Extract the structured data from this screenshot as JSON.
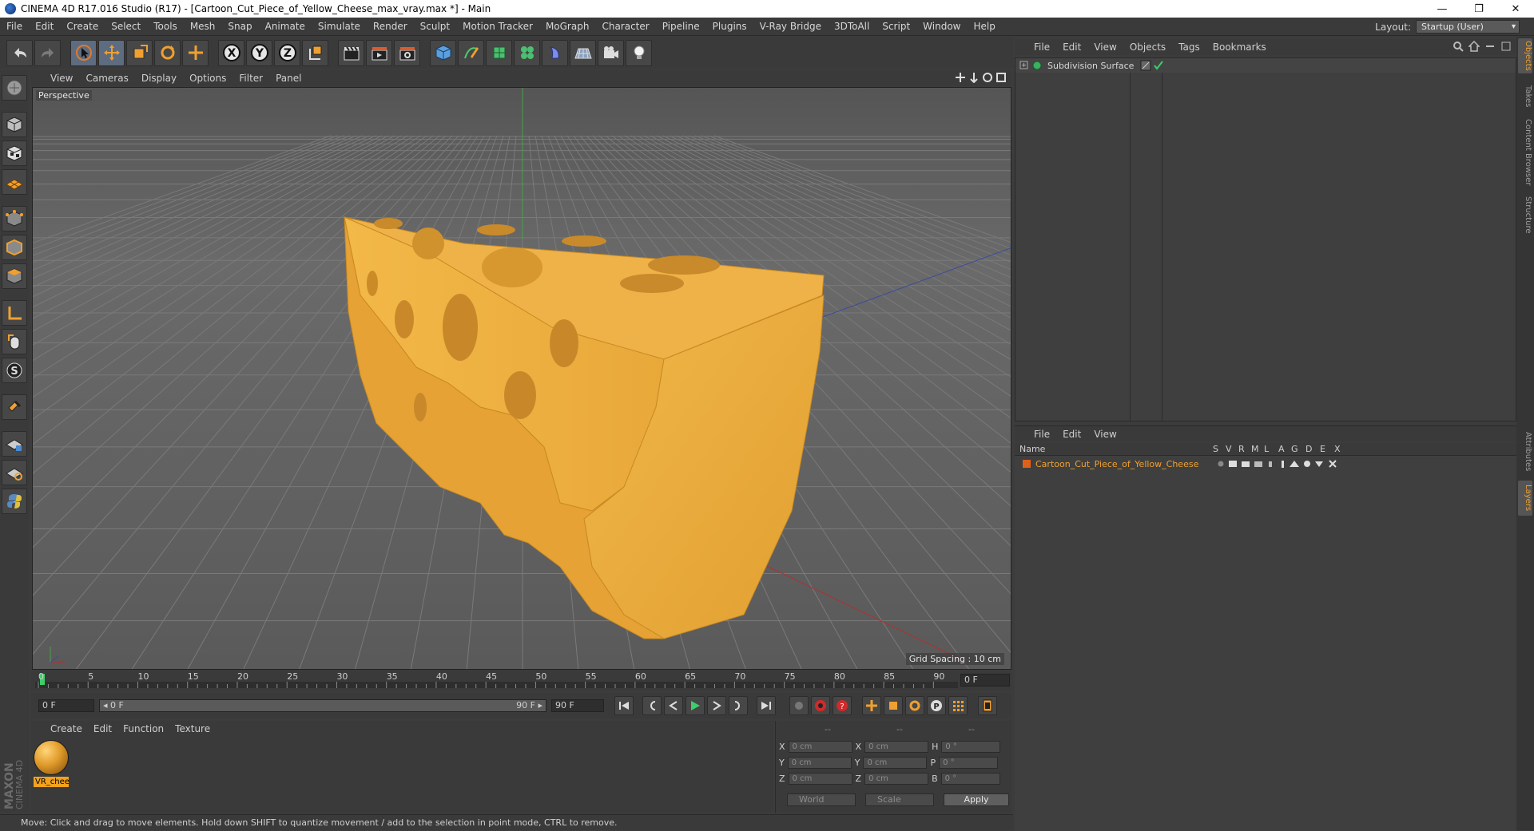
{
  "window": {
    "title": "CINEMA 4D R17.016 Studio (R17) - [Cartoon_Cut_Piece_of_Yellow_Cheese_max_vray.max *] - Main",
    "minimize": "—",
    "restore": "❐",
    "close": "✕"
  },
  "menubar": {
    "items": [
      "File",
      "Edit",
      "Create",
      "Select",
      "Tools",
      "Mesh",
      "Snap",
      "Animate",
      "Simulate",
      "Render",
      "Sculpt",
      "Motion Tracker",
      "MoGraph",
      "Character",
      "Pipeline",
      "Plugins",
      "V-Ray Bridge",
      "3DToAll",
      "Script",
      "Window",
      "Help"
    ],
    "layout_label": "Layout:",
    "layout_value": "Startup (User)"
  },
  "viewport": {
    "menu": [
      "View",
      "Cameras",
      "Display",
      "Options",
      "Filter",
      "Panel"
    ],
    "label": "Perspective",
    "grid_spacing": "Grid Spacing : 10 cm"
  },
  "timeline": {
    "ticks": [
      "0",
      "5",
      "10",
      "15",
      "20",
      "25",
      "30",
      "35",
      "40",
      "45",
      "50",
      "55",
      "60",
      "65",
      "70",
      "75",
      "80",
      "85",
      "90"
    ],
    "current_frame": "0 F",
    "start_field": "0 F",
    "range_start": "◂ 0 F",
    "range_end": "90 F ▸",
    "end_field": "90 F"
  },
  "material_manager": {
    "menu": [
      "Create",
      "Edit",
      "Function",
      "Texture"
    ],
    "material_name": "VR_chee"
  },
  "coordinates": {
    "header": [
      "--",
      "--",
      "--"
    ],
    "rows": [
      {
        "a": "X",
        "av": "0 cm",
        "b": "X",
        "bv": "0 cm",
        "c": "H",
        "cv": "0 °"
      },
      {
        "a": "Y",
        "av": "0 cm",
        "b": "Y",
        "bv": "0 cm",
        "c": "P",
        "cv": "0 °"
      },
      {
        "a": "Z",
        "av": "0 cm",
        "b": "Z",
        "bv": "0 cm",
        "c": "B",
        "cv": "0 °"
      }
    ],
    "world": "World",
    "scale": "Scale",
    "apply": "Apply"
  },
  "status": {
    "text": "Move: Click and drag to move elements. Hold down SHIFT to quantize movement / add to the selection in point mode, CTRL to remove."
  },
  "object_manager": {
    "menu": [
      "File",
      "Edit",
      "View",
      "Objects",
      "Tags",
      "Bookmarks"
    ],
    "object_name": "Subdivision Surface"
  },
  "layer_manager": {
    "menu": [
      "File",
      "Edit",
      "View"
    ],
    "columns": [
      "Name",
      "S",
      "V",
      "R",
      "M",
      "L",
      "A",
      "G",
      "D",
      "E",
      "X"
    ],
    "layer_name": "Cartoon_Cut_Piece_of_Yellow_Cheese"
  },
  "right_tabs": [
    "Objects",
    "Takes",
    "Content Browser",
    "Structure",
    "Attributes",
    "Layers"
  ],
  "maxon": {
    "line1": "MAXON",
    "line2": "CINEMA 4D"
  },
  "colors": {
    "accent": "#f0a030",
    "cheese": "#e9a93a",
    "viewport_bg": "#5b5b5b"
  }
}
